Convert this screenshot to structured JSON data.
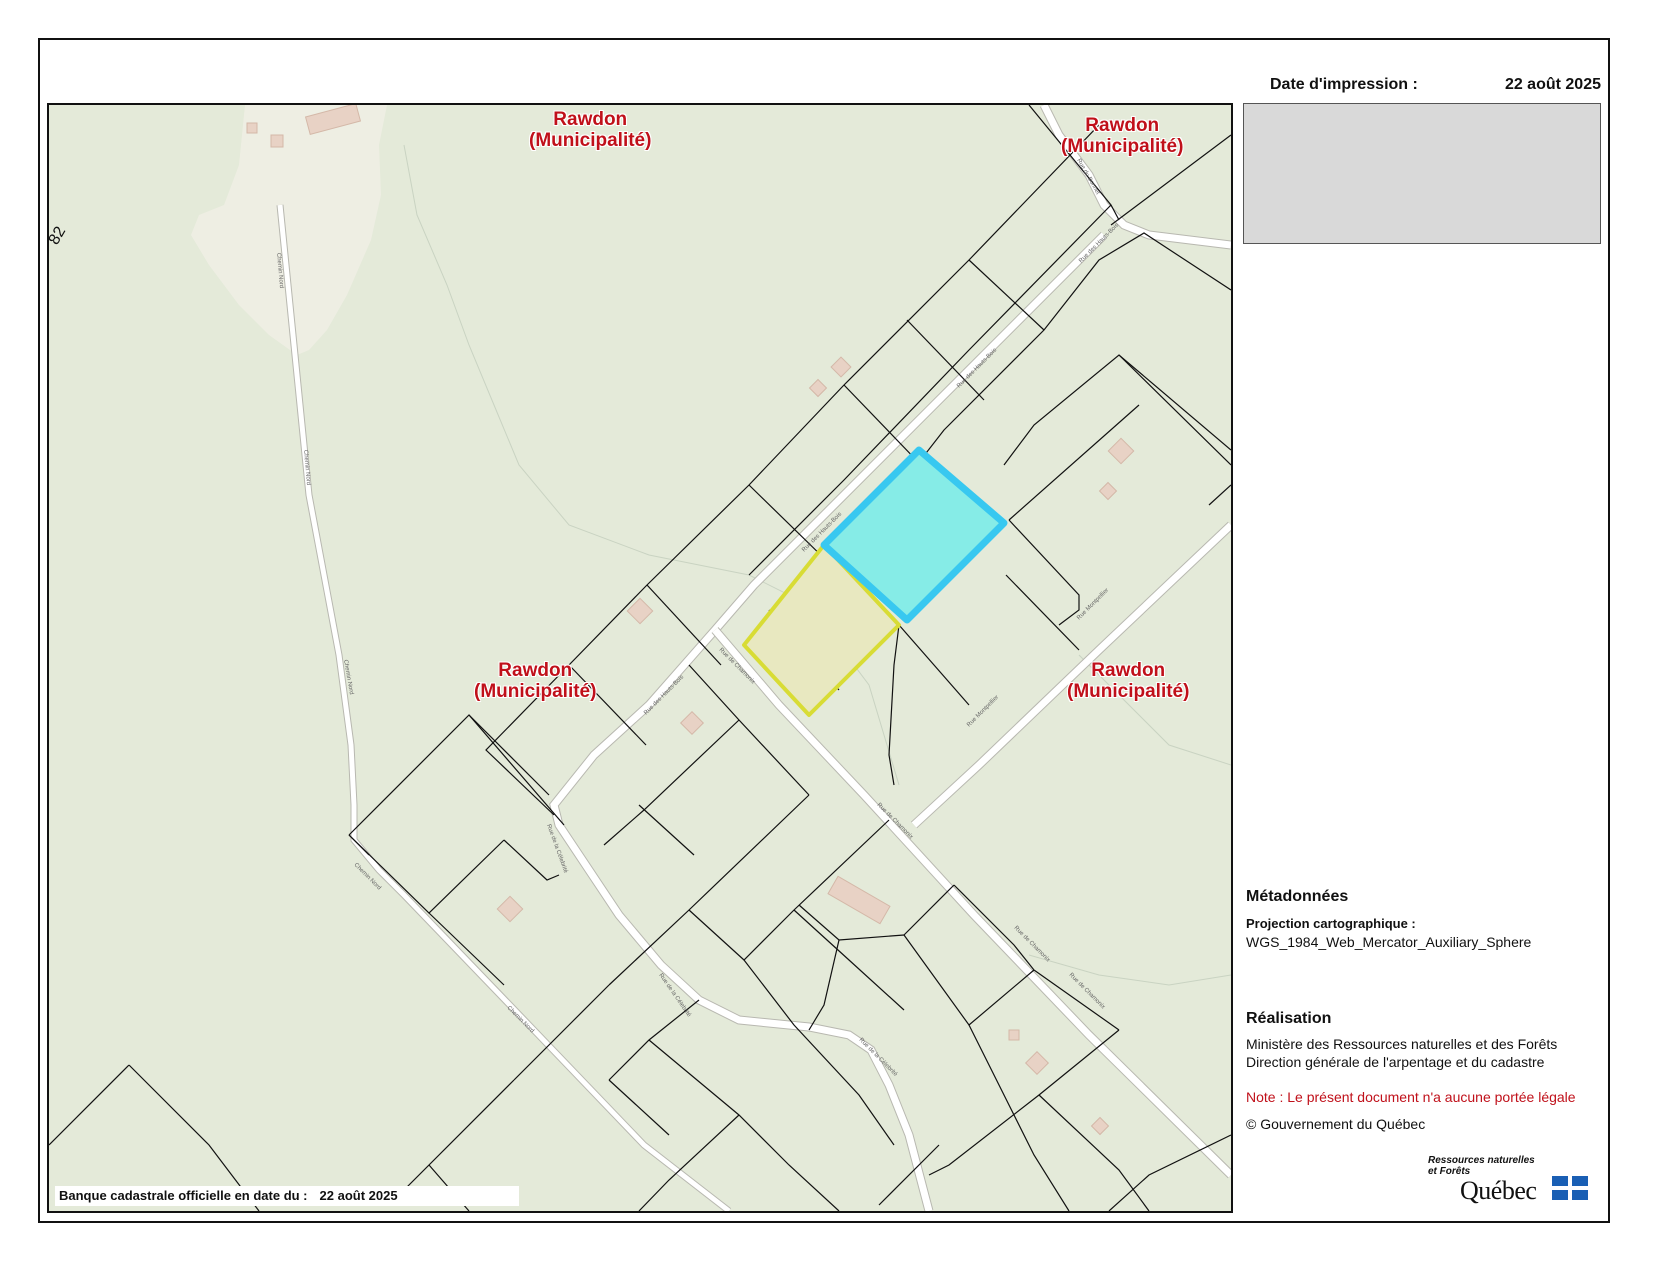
{
  "print_date": {
    "label": "Date d'impression :",
    "value": "22 août 2025"
  },
  "map": {
    "labels": [
      {
        "line1": "Rawdon",
        "line2": "(Municipalité)"
      },
      {
        "line1": "Rawdon",
        "line2": "(Municipalité)"
      },
      {
        "line1": "Rawdon",
        "line2": "(Municipalité)"
      },
      {
        "line1": "Rawdon",
        "line2": "(Municipalité)"
      }
    ],
    "edge_number": "82",
    "colors": {
      "background": "#e4ead9",
      "forest": "#dde6d1",
      "clearing": "#eeeee3",
      "road": "#ffffff",
      "road_edge": "#b8b8b0",
      "lot_line": "#111111",
      "selected_fill": "#86ece7",
      "selected_outline": "#38c8f0",
      "adjacent_fill": "#e8e8c0",
      "adjacent_outline": "#e8e834",
      "building": "#e8d2c5"
    }
  },
  "bank": {
    "label": "Banque cadastrale officielle en date du :",
    "value": "22 août 2025"
  },
  "metadata": {
    "heading": "Métadonnées",
    "projection_label": "Projection cartographique :",
    "projection_value": "WGS_1984_Web_Mercator_Auxiliary_Sphere"
  },
  "realisation": {
    "heading": "Réalisation",
    "line1": "Ministère des Ressources naturelles et des Forêts",
    "line2": "Direction générale de l'arpentage et du cadastre"
  },
  "note": "Note : Le présent document n'a aucune portée légale",
  "copyright": "© Gouvernement du Québec",
  "logo": {
    "line1": "Ressources naturelles",
    "line2": "et Forêts",
    "word": "Québec"
  }
}
